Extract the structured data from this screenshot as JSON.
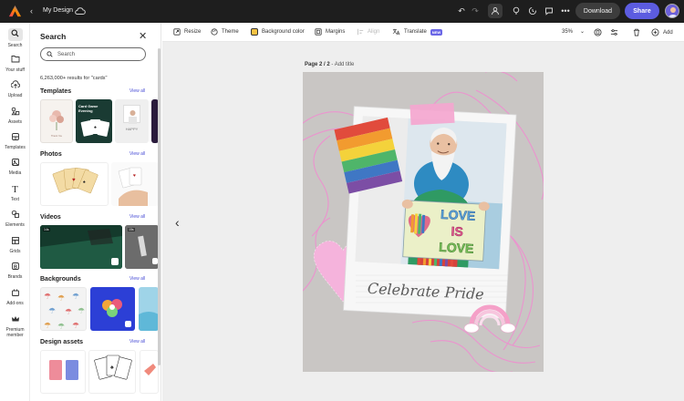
{
  "topbar": {
    "design_name": "My Design",
    "download_label": "Download",
    "share_label": "Share"
  },
  "rail": {
    "items": [
      {
        "label": "Search",
        "icon": "search-icon"
      },
      {
        "label": "Your stuff",
        "icon": "folder-icon"
      },
      {
        "label": "Upload",
        "icon": "upload-icon"
      },
      {
        "label": "Assets",
        "icon": "assets-icon"
      },
      {
        "label": "Templates",
        "icon": "templates-icon"
      },
      {
        "label": "Media",
        "icon": "media-icon"
      },
      {
        "label": "Text",
        "icon": "text-icon"
      },
      {
        "label": "Elements",
        "icon": "elements-icon"
      },
      {
        "label": "Grids",
        "icon": "grids-icon"
      },
      {
        "label": "Brands",
        "icon": "brands-icon"
      },
      {
        "label": "Add-ons",
        "icon": "addons-icon"
      },
      {
        "label": "Premium member",
        "icon": "crown-icon"
      }
    ]
  },
  "panel": {
    "title": "Search",
    "search_placeholder": "Search",
    "results_text": "6,263,000+ results for \"cards\"",
    "view_all": "View all",
    "sections": {
      "templates": "Templates",
      "photos": "Photos",
      "videos": "Videos",
      "backgrounds": "Backgrounds",
      "design_assets": "Design assets"
    },
    "template_texts": {
      "t1": "Thank You",
      "t2_title": "Card Game",
      "t2_sub": "Evening",
      "t3": "HAPPY"
    },
    "video_durations": [
      "14s",
      "15s"
    ]
  },
  "toolbar": {
    "resize": "Resize",
    "theme": "Theme",
    "background_color": "Background color",
    "margins": "Margins",
    "align": "Align",
    "translate": "Translate",
    "new_badge": "NEW",
    "zoom": "35%",
    "add": "Add"
  },
  "canvas": {
    "page_label_bold": "Page 2 / 2",
    "page_label_rest": " - Add title",
    "polaroid_caption": "Celebrate Pride",
    "sign_lines": [
      "LOVE",
      "IS",
      "LOVE"
    ]
  },
  "colors": {
    "topbar_bg": "#1e1e1e",
    "share_accent": "#5c5ce0",
    "link_blue": "#4a4fd6",
    "canvas_bg": "#eeeeee",
    "page_bg": "#c9c6c4",
    "pink_accent": "#ee82c8"
  }
}
